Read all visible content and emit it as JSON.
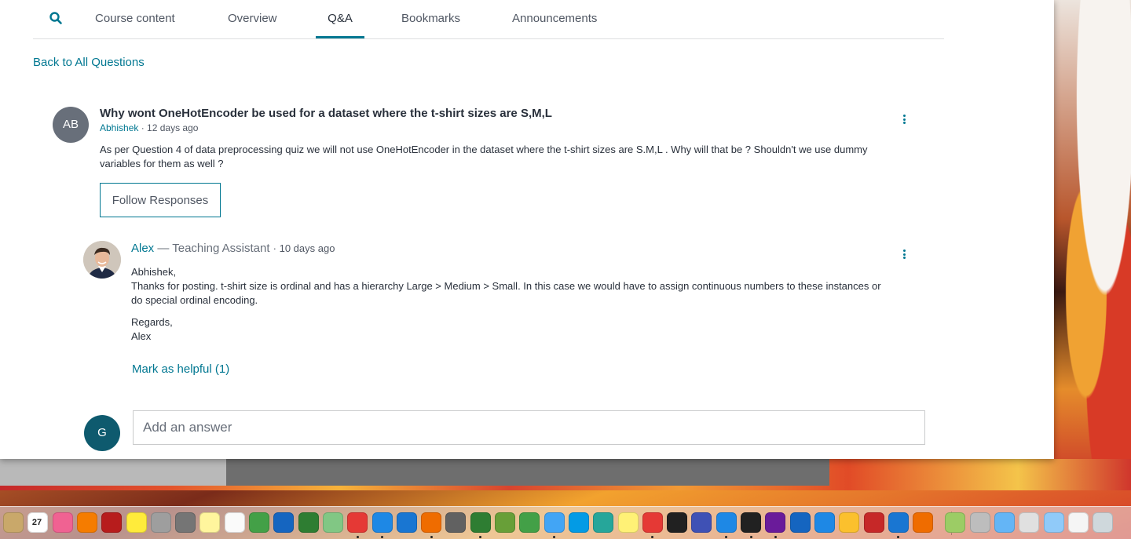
{
  "tabs": [
    {
      "label": "Course content"
    },
    {
      "label": "Overview"
    },
    {
      "label": "Q&A"
    },
    {
      "label": "Bookmarks"
    },
    {
      "label": "Announcements"
    }
  ],
  "active_tab": "Q&A",
  "back_link": "Back to All Questions",
  "question": {
    "avatar_initials": "AB",
    "title": "Why wont OneHotEncoder be used for a dataset where the t-shirt sizes are S,M,L",
    "author": "Abhishek",
    "time": "· 12 days ago",
    "body": "As per Question 4 of data preprocessing quiz we will not use OneHotEncoder in the dataset where the t-shirt sizes are S.M,L . Why will that be ? Shouldn't we use dummy variables for them as well ?",
    "follow_button": "Follow Responses"
  },
  "answer": {
    "author": "Alex",
    "role": " — Teaching Assistant ",
    "time": "· 10 days ago",
    "greeting": "Abhishek,",
    "text": "Thanks for posting. t-shirt size is ordinal and has a hierarchy Large > Medium > Small. In this case we would have to assign continuous numbers to these instances or do special ordinal encoding.",
    "signoff": "Regards,",
    "signature": "Alex",
    "helpful": "Mark as helpful (1)"
  },
  "reply": {
    "avatar_initials": "G",
    "placeholder": "Add an answer"
  },
  "colors": {
    "accent": "#007791",
    "text": "#29303b",
    "muted": "#686f7a",
    "question_avatar": "#686f7a",
    "user_avatar": "#0e5a6e"
  },
  "dock": {
    "calendar_day": "27",
    "items": [
      {
        "icon": "finder-stack-icon",
        "color": "#c9a86a"
      },
      {
        "icon": "calendar-icon",
        "color": "#ffffff"
      },
      {
        "icon": "itunes-icon",
        "color": "#f06292"
      },
      {
        "icon": "ibooks-icon",
        "color": "#f57c00"
      },
      {
        "icon": "photo-booth-icon",
        "color": "#b71c1c"
      },
      {
        "icon": "photos-icon",
        "color": "#ffeb3b"
      },
      {
        "icon": "preview-icon",
        "color": "#9e9e9e"
      },
      {
        "icon": "system-preferences-icon",
        "color": "#757575"
      },
      {
        "icon": "notes-icon",
        "color": "#fff59d"
      },
      {
        "icon": "reminders-icon",
        "color": "#fafafa"
      },
      {
        "icon": "anaconda-icon",
        "color": "#43a047"
      },
      {
        "icon": "outlook-icon",
        "color": "#1565c0"
      },
      {
        "icon": "evernote-icon",
        "color": "#2e7d32"
      },
      {
        "icon": "maps-icon",
        "color": "#81c784"
      },
      {
        "icon": "chrome-icon",
        "color": "#e53935"
      },
      {
        "icon": "safari-icon",
        "color": "#1e88e5"
      },
      {
        "icon": "cloud-upload-icon",
        "color": "#1976d2"
      },
      {
        "icon": "firefox-icon",
        "color": "#ef6c00"
      },
      {
        "icon": "calculator-icon",
        "color": "#616161"
      },
      {
        "icon": "excel-icon",
        "color": "#2e7d32"
      },
      {
        "icon": "network-globe-icon",
        "color": "#689f38"
      },
      {
        "icon": "facetime-icon",
        "color": "#43a047"
      },
      {
        "icon": "messages-icon",
        "color": "#42a5f5"
      },
      {
        "icon": "skype-icon",
        "color": "#039be5"
      },
      {
        "icon": "grammarly-icon",
        "color": "#26a69a"
      },
      {
        "icon": "sketchbook-icon",
        "color": "#fff176"
      },
      {
        "icon": "scrobbler-icon",
        "color": "#e53935"
      },
      {
        "icon": "activity-monitor-icon",
        "color": "#212121"
      },
      {
        "icon": "r-language-icon",
        "color": "#3f51b5"
      },
      {
        "icon": "chat-bubble-icon",
        "color": "#1e88e5"
      },
      {
        "icon": "terminal-icon",
        "color": "#212121"
      },
      {
        "icon": "github-icon",
        "color": "#6a1b9a"
      },
      {
        "icon": "location-pin-icon",
        "color": "#1565c0"
      },
      {
        "icon": "virtualbox-icon",
        "color": "#1e88e5"
      },
      {
        "icon": "google-drive-icon",
        "color": "#fbc02d"
      },
      {
        "icon": "quora-icon",
        "color": "#c62828"
      },
      {
        "icon": "grid-app-icon",
        "color": "#1976d2"
      },
      {
        "icon": "sublime-text-icon",
        "color": "#ef6c00"
      },
      {
        "icon": "image-folder-icon",
        "color": "#9ccc65"
      },
      {
        "icon": "printer-icon",
        "color": "#bdbdbd"
      },
      {
        "icon": "folder-icon",
        "color": "#64b5f6"
      },
      {
        "icon": "documents-icon",
        "color": "#e0e0e0"
      },
      {
        "icon": "applications-folder-icon",
        "color": "#90caf9"
      },
      {
        "icon": "battery-window-icon",
        "color": "#f5f5f5"
      },
      {
        "icon": "trash-icon",
        "color": "#cfd8dc"
      }
    ]
  }
}
